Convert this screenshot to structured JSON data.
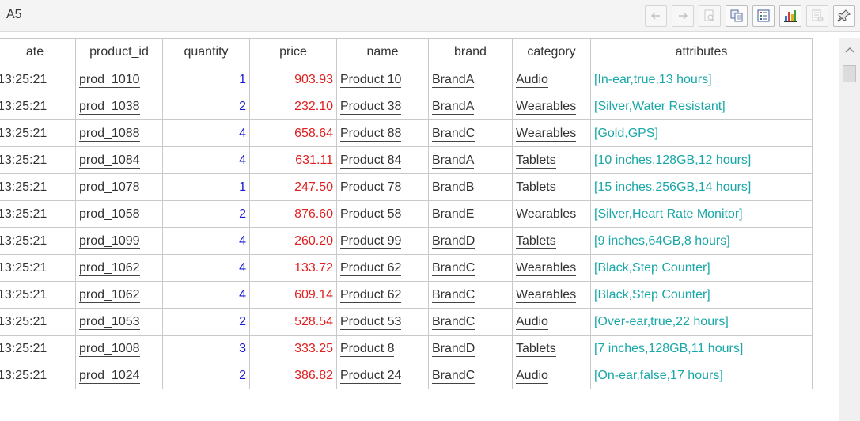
{
  "cell_ref": "A5",
  "toolbar": [
    {
      "name": "back-arrow-icon",
      "disabled": true
    },
    {
      "name": "forward-arrow-icon",
      "disabled": true
    },
    {
      "name": "zoom-icon",
      "disabled": true
    },
    {
      "name": "copy-icon",
      "disabled": false
    },
    {
      "name": "list-view-icon",
      "disabled": false
    },
    {
      "name": "bar-chart-icon",
      "disabled": false
    },
    {
      "name": "properties-icon",
      "disabled": true
    },
    {
      "name": "pin-icon",
      "disabled": false
    }
  ],
  "table": {
    "columns": [
      "ate",
      "product_id",
      "quantity",
      "price",
      "name",
      "brand",
      "category",
      "attributes"
    ],
    "rows": [
      [
        "13:25:21",
        "prod_1010",
        "1",
        "903.93",
        "Product 10",
        "BrandA",
        "Audio",
        "[In-ear,true,13 hours]"
      ],
      [
        "13:25:21",
        "prod_1038",
        "2",
        "232.10",
        "Product 38",
        "BrandA",
        "Wearables",
        "[Silver,Water Resistant]"
      ],
      [
        "13:25:21",
        "prod_1088",
        "4",
        "658.64",
        "Product 88",
        "BrandC",
        "Wearables",
        "[Gold,GPS]"
      ],
      [
        "13:25:21",
        "prod_1084",
        "4",
        "631.11",
        "Product 84",
        "BrandA",
        "Tablets",
        "[10 inches,128GB,12 hours]"
      ],
      [
        "13:25:21",
        "prod_1078",
        "1",
        "247.50",
        "Product 78",
        "BrandB",
        "Tablets",
        "[15 inches,256GB,14 hours]"
      ],
      [
        "13:25:21",
        "prod_1058",
        "2",
        "876.60",
        "Product 58",
        "BrandE",
        "Wearables",
        "[Silver,Heart Rate Monitor]"
      ],
      [
        "13:25:21",
        "prod_1099",
        "4",
        "260.20",
        "Product 99",
        "BrandD",
        "Tablets",
        "[9 inches,64GB,8 hours]"
      ],
      [
        "13:25:21",
        "prod_1062",
        "4",
        "133.72",
        "Product 62",
        "BrandC",
        "Wearables",
        "[Black,Step Counter]"
      ],
      [
        "13:25:21",
        "prod_1062",
        "4",
        "609.14",
        "Product 62",
        "BrandC",
        "Wearables",
        "[Black,Step Counter]"
      ],
      [
        "13:25:21",
        "prod_1053",
        "2",
        "528.54",
        "Product 53",
        "BrandC",
        "Audio",
        "[Over-ear,true,22 hours]"
      ],
      [
        "13:25:21",
        "prod_1008",
        "3",
        "333.25",
        "Product 8",
        "BrandD",
        "Tablets",
        "[7 inches,128GB,11 hours]"
      ],
      [
        "13:25:21",
        "prod_1024",
        "2",
        "386.82",
        "Product 24",
        "BrandC",
        "Audio",
        "[On-ear,false,17 hours]"
      ]
    ]
  },
  "colors": {
    "quantity": "#1a1ad6",
    "price": "#e02020",
    "attributes": "#1aa7a7"
  }
}
